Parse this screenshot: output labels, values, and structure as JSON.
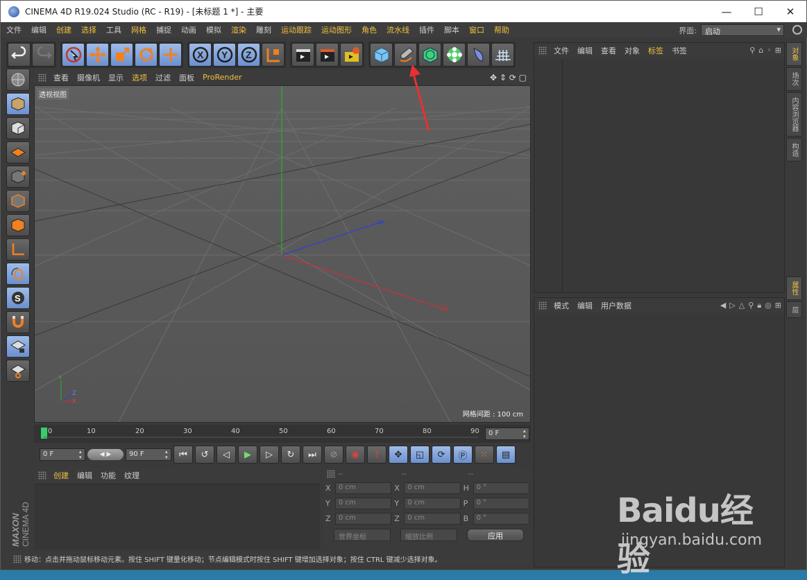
{
  "window": {
    "title": "CINEMA 4D R19.024 Studio (RC - R19) - [未标题 1 *] - 主要",
    "min": "—",
    "max": "☐",
    "close": "✕"
  },
  "menu": [
    "文件",
    "编辑",
    "创建",
    "选择",
    "工具",
    "网格",
    "捕捉",
    "动画",
    "模拟",
    "渲染",
    "雕刻",
    "运动跟踪",
    "运动图形",
    "角色",
    "流水线",
    "插件",
    "脚本",
    "窗口",
    "帮助"
  ],
  "layout": {
    "label": "界面:",
    "value": "启动"
  },
  "viewport": {
    "menu": [
      "查看",
      "摄像机",
      "显示",
      "选项",
      "过滤",
      "面板",
      "ProRender"
    ],
    "label": "透视视图",
    "grid_status": "网格间距 : 100 cm",
    "axis_labels": {
      "y": "Y",
      "z": "Z",
      "x": "X"
    }
  },
  "timeline": {
    "ticks": [
      "0",
      "10",
      "20",
      "30",
      "40",
      "50",
      "60",
      "70",
      "80",
      "90"
    ],
    "frame_field": "0 F"
  },
  "transport": {
    "start": "0 F",
    "end": "90 F"
  },
  "material_manager": {
    "menu": [
      "创建",
      "编辑",
      "功能",
      "纹理"
    ]
  },
  "coordinates": {
    "header": [
      "--",
      "--",
      "--"
    ],
    "rows": [
      {
        "a": "X",
        "v1": "0 cm",
        "b": "X",
        "v2": "0 cm",
        "c": "H",
        "v3": "0 °"
      },
      {
        "a": "Y",
        "v1": "0 cm",
        "b": "Y",
        "v2": "0 cm",
        "c": "P",
        "v3": "0 °"
      },
      {
        "a": "Z",
        "v1": "0 cm",
        "b": "Z",
        "v2": "0 cm",
        "c": "B",
        "v3": "0 °"
      }
    ],
    "world": "世界坐标",
    "scale": "缩放比例",
    "apply": "应用"
  },
  "status": "移动：点击并拖动鼠标移动元素。按住 SHIFT 键量化移动；节点编辑模式时按住 SHIFT 键增加选择对象；按住 CTRL 键减少选择对象。",
  "object_manager": {
    "menu": [
      "文件",
      "编辑",
      "查看",
      "对象",
      "标签",
      "书签"
    ]
  },
  "attribute_manager": {
    "menu": [
      "模式",
      "编辑",
      "用户数据"
    ]
  },
  "side_tabs_top": [
    "对象",
    "场次",
    "内容浏览器",
    "构造"
  ],
  "side_tabs_bottom": [
    "属性",
    "层"
  ],
  "brand": {
    "maxon": "MAXON",
    "product": "CINEMA 4D"
  },
  "watermark": {
    "main": "Baidu经验",
    "sub": "jingyan.baidu.com"
  }
}
